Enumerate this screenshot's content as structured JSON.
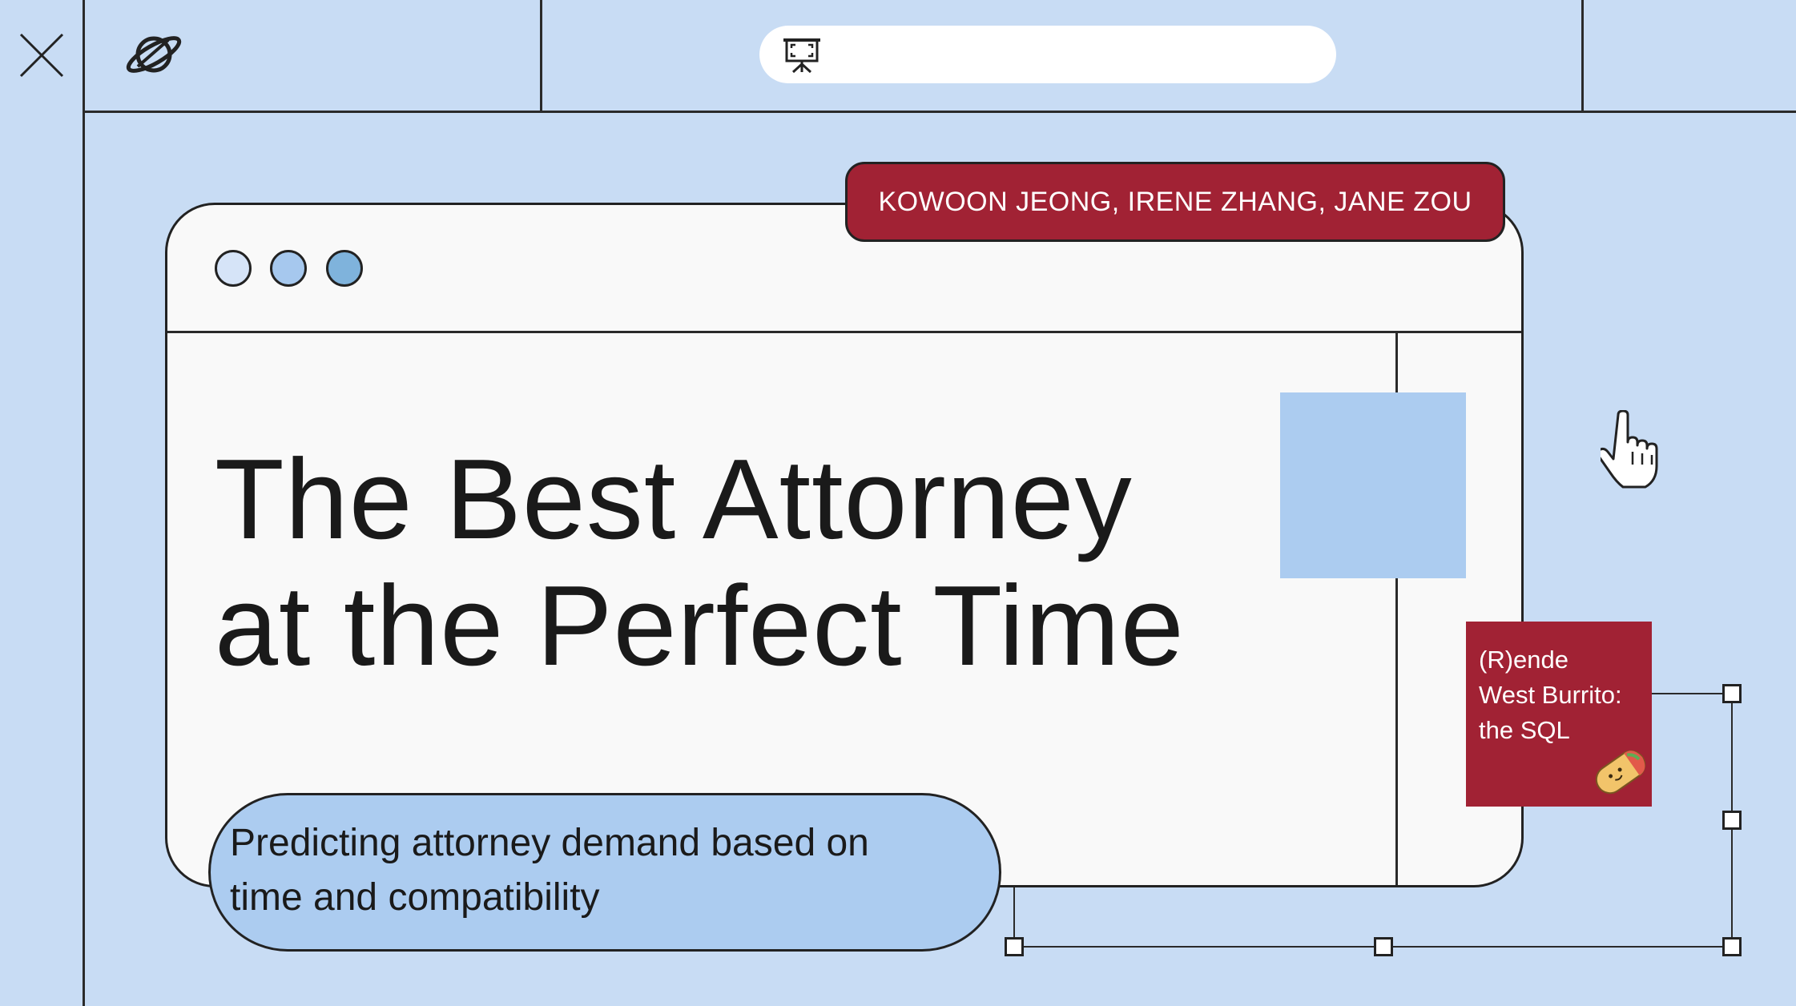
{
  "slide": {
    "authors": "KOWOON JEONG, IRENE ZHANG, JANE ZOU",
    "title_line1": "The Best Attorney",
    "title_line2": "at the Perfect Time",
    "subtitle_line1": "Predicting attorney demand based on",
    "subtitle_line2": "time and compatibility",
    "team_line1": "(R)ende",
    "team_line2": "West Burrito:",
    "team_line3": "the SQL"
  },
  "colors": {
    "background": "#c8dcf4",
    "accent_red": "#a12234",
    "light_blue": "#acccf0",
    "window_bg": "#f9f9f9"
  },
  "icons": {
    "close": "close-icon",
    "planet": "planet-icon",
    "presentation": "presentation-icon",
    "cursor": "hand-cursor-icon",
    "burrito": "burrito-icon"
  }
}
